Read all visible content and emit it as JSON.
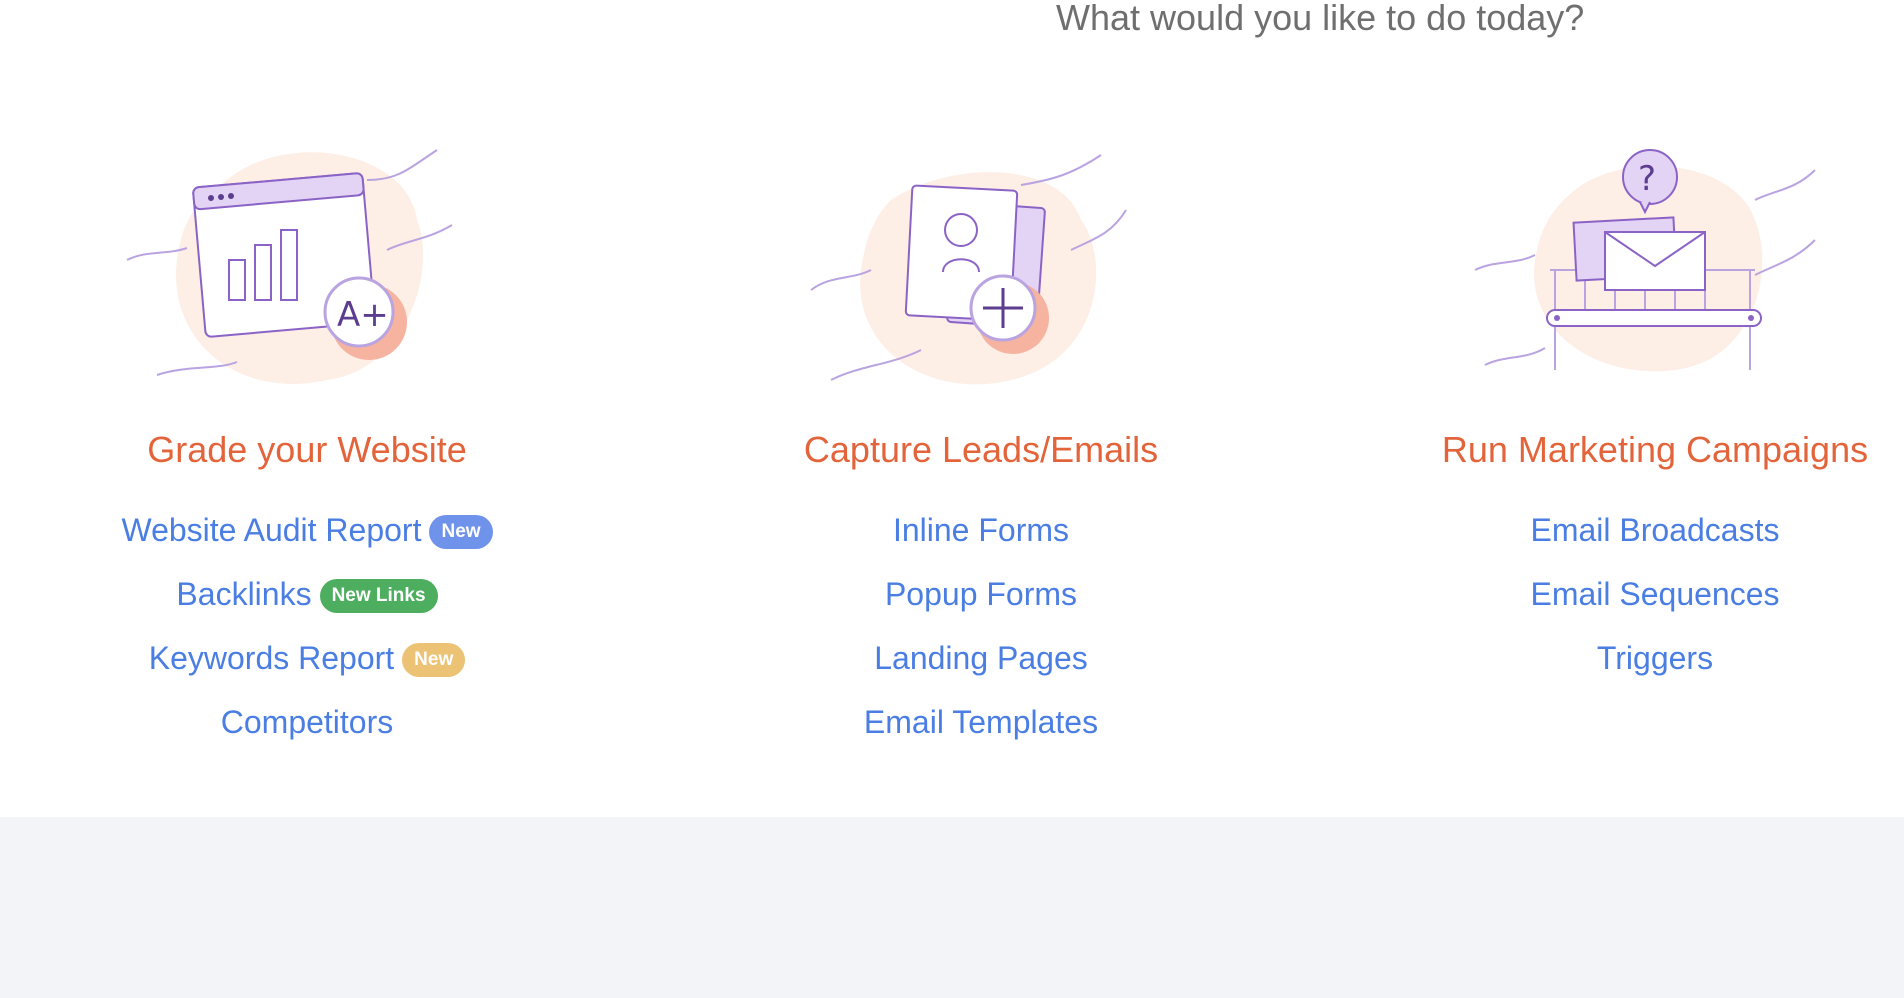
{
  "heading": "What would you like to do today?",
  "colors": {
    "title": "#e3643b",
    "link": "#4a7ee3",
    "badge_blue": "#6f92ea",
    "badge_green": "#4cae5e",
    "badge_yellow": "#ecc274",
    "illustration_purple": "#8b63c6",
    "illustration_blob": "#fdeee6",
    "footer_bg": "#f3f4f8"
  },
  "columns": [
    {
      "title": "Grade your Website",
      "illustration": "website-grade-illustration",
      "links": [
        {
          "label": "Website Audit Report",
          "badge": "New",
          "badge_color": "#6f92ea"
        },
        {
          "label": "Backlinks",
          "badge": "New Links",
          "badge_color": "#4cae5e"
        },
        {
          "label": "Keywords Report",
          "badge": "New",
          "badge_color": "#ecc274"
        },
        {
          "label": "Competitors",
          "badge": "",
          "badge_color": ""
        }
      ]
    },
    {
      "title": "Capture Leads/Emails",
      "illustration": "capture-leads-illustration",
      "links": [
        {
          "label": "Inline Forms"
        },
        {
          "label": "Popup Forms"
        },
        {
          "label": "Landing Pages"
        },
        {
          "label": "Email Templates"
        }
      ]
    },
    {
      "title": "Run Marketing Campaigns",
      "illustration": "marketing-campaigns-illustration",
      "links": [
        {
          "label": "Email Broadcasts"
        },
        {
          "label": "Email Sequences"
        },
        {
          "label": "Triggers"
        }
      ]
    }
  ]
}
